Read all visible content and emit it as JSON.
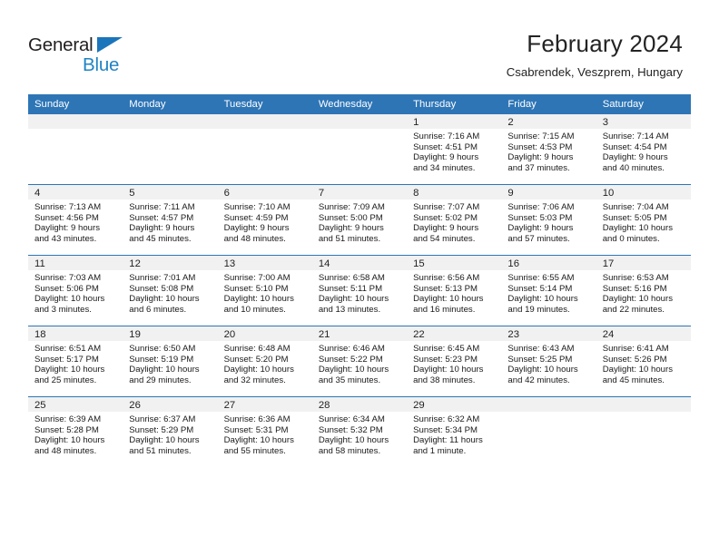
{
  "brand": {
    "name_top": "General",
    "name_bottom": "Blue",
    "triangle_icon": "blue-triangle-icon",
    "color_dark": "#231f20",
    "color_blue": "#2183c4"
  },
  "header": {
    "title": "February 2024",
    "subtitle": "Csabrendek, Veszprem, Hungary"
  },
  "theme": {
    "header_blue": "#2e75b6",
    "daynum_band": "#f1f1f1",
    "text": "#1a1a1a"
  },
  "weekday_headers": [
    "Sunday",
    "Monday",
    "Tuesday",
    "Wednesday",
    "Thursday",
    "Friday",
    "Saturday"
  ],
  "weeks": [
    [
      {
        "day": "",
        "sunrise": "",
        "sunset": "",
        "daylight_line1": "",
        "daylight_line2": ""
      },
      {
        "day": "",
        "sunrise": "",
        "sunset": "",
        "daylight_line1": "",
        "daylight_line2": ""
      },
      {
        "day": "",
        "sunrise": "",
        "sunset": "",
        "daylight_line1": "",
        "daylight_line2": ""
      },
      {
        "day": "",
        "sunrise": "",
        "sunset": "",
        "daylight_line1": "",
        "daylight_line2": ""
      },
      {
        "day": "1",
        "sunrise": "Sunrise: 7:16 AM",
        "sunset": "Sunset: 4:51 PM",
        "daylight_line1": "Daylight: 9 hours",
        "daylight_line2": "and 34 minutes."
      },
      {
        "day": "2",
        "sunrise": "Sunrise: 7:15 AM",
        "sunset": "Sunset: 4:53 PM",
        "daylight_line1": "Daylight: 9 hours",
        "daylight_line2": "and 37 minutes."
      },
      {
        "day": "3",
        "sunrise": "Sunrise: 7:14 AM",
        "sunset": "Sunset: 4:54 PM",
        "daylight_line1": "Daylight: 9 hours",
        "daylight_line2": "and 40 minutes."
      }
    ],
    [
      {
        "day": "4",
        "sunrise": "Sunrise: 7:13 AM",
        "sunset": "Sunset: 4:56 PM",
        "daylight_line1": "Daylight: 9 hours",
        "daylight_line2": "and 43 minutes."
      },
      {
        "day": "5",
        "sunrise": "Sunrise: 7:11 AM",
        "sunset": "Sunset: 4:57 PM",
        "daylight_line1": "Daylight: 9 hours",
        "daylight_line2": "and 45 minutes."
      },
      {
        "day": "6",
        "sunrise": "Sunrise: 7:10 AM",
        "sunset": "Sunset: 4:59 PM",
        "daylight_line1": "Daylight: 9 hours",
        "daylight_line2": "and 48 minutes."
      },
      {
        "day": "7",
        "sunrise": "Sunrise: 7:09 AM",
        "sunset": "Sunset: 5:00 PM",
        "daylight_line1": "Daylight: 9 hours",
        "daylight_line2": "and 51 minutes."
      },
      {
        "day": "8",
        "sunrise": "Sunrise: 7:07 AM",
        "sunset": "Sunset: 5:02 PM",
        "daylight_line1": "Daylight: 9 hours",
        "daylight_line2": "and 54 minutes."
      },
      {
        "day": "9",
        "sunrise": "Sunrise: 7:06 AM",
        "sunset": "Sunset: 5:03 PM",
        "daylight_line1": "Daylight: 9 hours",
        "daylight_line2": "and 57 minutes."
      },
      {
        "day": "10",
        "sunrise": "Sunrise: 7:04 AM",
        "sunset": "Sunset: 5:05 PM",
        "daylight_line1": "Daylight: 10 hours",
        "daylight_line2": "and 0 minutes."
      }
    ],
    [
      {
        "day": "11",
        "sunrise": "Sunrise: 7:03 AM",
        "sunset": "Sunset: 5:06 PM",
        "daylight_line1": "Daylight: 10 hours",
        "daylight_line2": "and 3 minutes."
      },
      {
        "day": "12",
        "sunrise": "Sunrise: 7:01 AM",
        "sunset": "Sunset: 5:08 PM",
        "daylight_line1": "Daylight: 10 hours",
        "daylight_line2": "and 6 minutes."
      },
      {
        "day": "13",
        "sunrise": "Sunrise: 7:00 AM",
        "sunset": "Sunset: 5:10 PM",
        "daylight_line1": "Daylight: 10 hours",
        "daylight_line2": "and 10 minutes."
      },
      {
        "day": "14",
        "sunrise": "Sunrise: 6:58 AM",
        "sunset": "Sunset: 5:11 PM",
        "daylight_line1": "Daylight: 10 hours",
        "daylight_line2": "and 13 minutes."
      },
      {
        "day": "15",
        "sunrise": "Sunrise: 6:56 AM",
        "sunset": "Sunset: 5:13 PM",
        "daylight_line1": "Daylight: 10 hours",
        "daylight_line2": "and 16 minutes."
      },
      {
        "day": "16",
        "sunrise": "Sunrise: 6:55 AM",
        "sunset": "Sunset: 5:14 PM",
        "daylight_line1": "Daylight: 10 hours",
        "daylight_line2": "and 19 minutes."
      },
      {
        "day": "17",
        "sunrise": "Sunrise: 6:53 AM",
        "sunset": "Sunset: 5:16 PM",
        "daylight_line1": "Daylight: 10 hours",
        "daylight_line2": "and 22 minutes."
      }
    ],
    [
      {
        "day": "18",
        "sunrise": "Sunrise: 6:51 AM",
        "sunset": "Sunset: 5:17 PM",
        "daylight_line1": "Daylight: 10 hours",
        "daylight_line2": "and 25 minutes."
      },
      {
        "day": "19",
        "sunrise": "Sunrise: 6:50 AM",
        "sunset": "Sunset: 5:19 PM",
        "daylight_line1": "Daylight: 10 hours",
        "daylight_line2": "and 29 minutes."
      },
      {
        "day": "20",
        "sunrise": "Sunrise: 6:48 AM",
        "sunset": "Sunset: 5:20 PM",
        "daylight_line1": "Daylight: 10 hours",
        "daylight_line2": "and 32 minutes."
      },
      {
        "day": "21",
        "sunrise": "Sunrise: 6:46 AM",
        "sunset": "Sunset: 5:22 PM",
        "daylight_line1": "Daylight: 10 hours",
        "daylight_line2": "and 35 minutes."
      },
      {
        "day": "22",
        "sunrise": "Sunrise: 6:45 AM",
        "sunset": "Sunset: 5:23 PM",
        "daylight_line1": "Daylight: 10 hours",
        "daylight_line2": "and 38 minutes."
      },
      {
        "day": "23",
        "sunrise": "Sunrise: 6:43 AM",
        "sunset": "Sunset: 5:25 PM",
        "daylight_line1": "Daylight: 10 hours",
        "daylight_line2": "and 42 minutes."
      },
      {
        "day": "24",
        "sunrise": "Sunrise: 6:41 AM",
        "sunset": "Sunset: 5:26 PM",
        "daylight_line1": "Daylight: 10 hours",
        "daylight_line2": "and 45 minutes."
      }
    ],
    [
      {
        "day": "25",
        "sunrise": "Sunrise: 6:39 AM",
        "sunset": "Sunset: 5:28 PM",
        "daylight_line1": "Daylight: 10 hours",
        "daylight_line2": "and 48 minutes."
      },
      {
        "day": "26",
        "sunrise": "Sunrise: 6:37 AM",
        "sunset": "Sunset: 5:29 PM",
        "daylight_line1": "Daylight: 10 hours",
        "daylight_line2": "and 51 minutes."
      },
      {
        "day": "27",
        "sunrise": "Sunrise: 6:36 AM",
        "sunset": "Sunset: 5:31 PM",
        "daylight_line1": "Daylight: 10 hours",
        "daylight_line2": "and 55 minutes."
      },
      {
        "day": "28",
        "sunrise": "Sunrise: 6:34 AM",
        "sunset": "Sunset: 5:32 PM",
        "daylight_line1": "Daylight: 10 hours",
        "daylight_line2": "and 58 minutes."
      },
      {
        "day": "29",
        "sunrise": "Sunrise: 6:32 AM",
        "sunset": "Sunset: 5:34 PM",
        "daylight_line1": "Daylight: 11 hours",
        "daylight_line2": "and 1 minute."
      },
      {
        "day": "",
        "sunrise": "",
        "sunset": "",
        "daylight_line1": "",
        "daylight_line2": ""
      },
      {
        "day": "",
        "sunrise": "",
        "sunset": "",
        "daylight_line1": "",
        "daylight_line2": ""
      }
    ]
  ]
}
